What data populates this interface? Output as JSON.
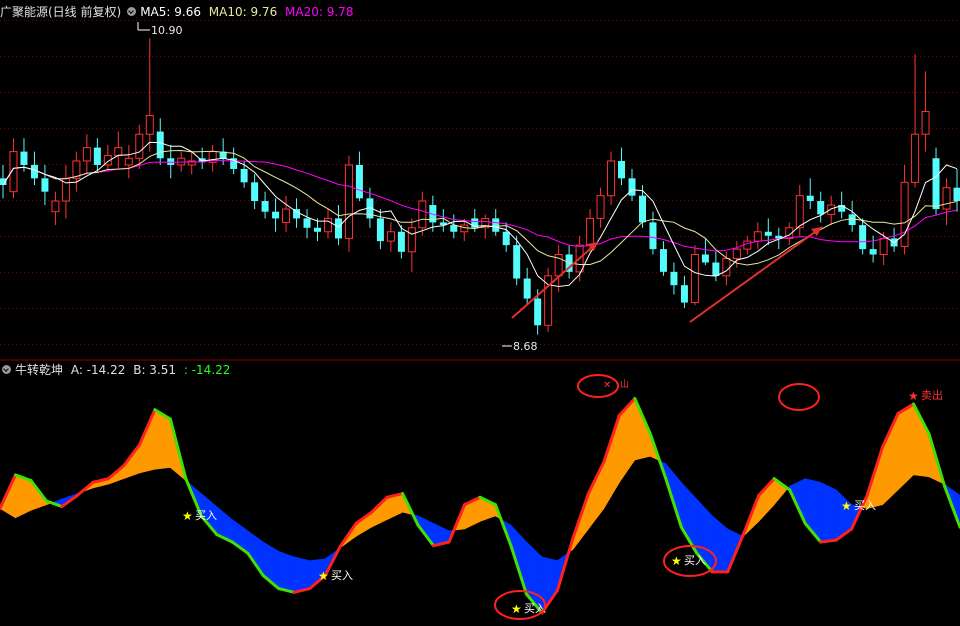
{
  "price_panel": {
    "title": "广聚能源(日线 前复权)",
    "ma5_label": "MA5: 9.66",
    "ma10_label": "MA10: 9.76",
    "ma20_label": "MA20: 9.78",
    "high_label": "10.90",
    "low_label": "8.68",
    "colors": {
      "up": "#ff3232",
      "down": "#54fcfc",
      "ma5": "#ffffff",
      "ma10": "#e8e8a0",
      "ma20": "#ff00ff",
      "grid": "#7a0000"
    }
  },
  "indicator_panel": {
    "title": "牛转乾坤",
    "a_label": "A: -14.22",
    "b_label": "B: 3.51",
    "c_label": ": -14.22",
    "colors": {
      "up_fill": "#ff9900",
      "down_fill": "#0033ff",
      "rise_line": "#ff2020",
      "fall_line": "#40e000",
      "star": "#ffff00",
      "circle": "#ff2020"
    }
  },
  "chart_data": [
    {
      "type": "candlestick",
      "title": "广聚能源(日线 前复权)",
      "ylim": [
        8.55,
        11.05
      ],
      "annotations": [
        {
          "text": "10.90",
          "value": 10.9
        },
        {
          "text": "8.68",
          "value": 8.68
        }
      ],
      "ohlc": [
        [
          9.85,
          9.95,
          9.7,
          9.8
        ],
        [
          9.75,
          10.15,
          9.7,
          10.05
        ],
        [
          10.05,
          10.15,
          9.9,
          9.95
        ],
        [
          9.95,
          10.05,
          9.8,
          9.85
        ],
        [
          9.85,
          9.95,
          9.65,
          9.75
        ],
        [
          9.6,
          9.75,
          9.5,
          9.68
        ],
        [
          9.68,
          9.95,
          9.55,
          9.85
        ],
        [
          9.85,
          10.05,
          9.75,
          9.98
        ],
        [
          9.98,
          10.18,
          9.88,
          10.08
        ],
        [
          10.08,
          10.15,
          9.9,
          9.95
        ],
        [
          9.95,
          10.1,
          9.9,
          10.02
        ],
        [
          10.02,
          10.2,
          9.92,
          10.08
        ],
        [
          9.95,
          10.1,
          9.85,
          10.0
        ],
        [
          10.0,
          10.25,
          9.92,
          10.18
        ],
        [
          10.18,
          10.9,
          10.05,
          10.32
        ],
        [
          10.2,
          10.3,
          9.95,
          10.0
        ],
        [
          10.0,
          10.1,
          9.85,
          9.95
        ],
        [
          9.95,
          10.05,
          9.9,
          10.0
        ],
        [
          9.95,
          10.05,
          9.88,
          9.98
        ],
        [
          10.0,
          10.08,
          9.92,
          9.97
        ],
        [
          9.97,
          10.1,
          9.9,
          10.05
        ],
        [
          10.05,
          10.15,
          9.95,
          10.0
        ],
        [
          10.0,
          10.08,
          9.88,
          9.92
        ],
        [
          9.92,
          9.98,
          9.78,
          9.82
        ],
        [
          9.82,
          9.88,
          9.62,
          9.68
        ],
        [
          9.68,
          9.75,
          9.55,
          9.6
        ],
        [
          9.6,
          9.7,
          9.45,
          9.55
        ],
        [
          9.52,
          9.72,
          9.45,
          9.62
        ],
        [
          9.62,
          9.7,
          9.48,
          9.55
        ],
        [
          9.55,
          9.62,
          9.4,
          9.48
        ],
        [
          9.48,
          9.55,
          9.38,
          9.45
        ],
        [
          9.45,
          9.62,
          9.4,
          9.55
        ],
        [
          9.55,
          9.65,
          9.35,
          9.4
        ],
        [
          9.4,
          10.02,
          9.3,
          9.95
        ],
        [
          9.95,
          10.05,
          9.68,
          9.7
        ],
        [
          9.7,
          9.78,
          9.48,
          9.55
        ],
        [
          9.55,
          9.62,
          9.32,
          9.38
        ],
        [
          9.38,
          9.52,
          9.3,
          9.45
        ],
        [
          9.45,
          9.5,
          9.25,
          9.3
        ],
        [
          9.3,
          9.55,
          9.15,
          9.48
        ],
        [
          9.48,
          9.75,
          9.42,
          9.68
        ],
        [
          9.65,
          9.72,
          9.45,
          9.52
        ],
        [
          9.52,
          9.62,
          9.45,
          9.5
        ],
        [
          9.5,
          9.58,
          9.4,
          9.45
        ],
        [
          9.45,
          9.55,
          9.38,
          9.5
        ],
        [
          9.55,
          9.62,
          9.45,
          9.48
        ],
        [
          9.48,
          9.58,
          9.4,
          9.55
        ],
        [
          9.55,
          9.62,
          9.42,
          9.45
        ],
        [
          9.45,
          9.52,
          9.3,
          9.35
        ],
        [
          9.35,
          9.42,
          9.05,
          9.1
        ],
        [
          9.1,
          9.18,
          8.9,
          8.95
        ],
        [
          8.95,
          9.02,
          8.68,
          8.75
        ],
        [
          8.75,
          9.18,
          8.7,
          9.12
        ],
        [
          9.12,
          9.35,
          9.0,
          9.28
        ],
        [
          9.28,
          9.35,
          9.1,
          9.15
        ],
        [
          9.15,
          9.42,
          9.08,
          9.35
        ],
        [
          9.35,
          9.62,
          9.3,
          9.55
        ],
        [
          9.55,
          9.78,
          9.48,
          9.72
        ],
        [
          9.72,
          10.05,
          9.65,
          9.98
        ],
        [
          9.98,
          10.08,
          9.8,
          9.85
        ],
        [
          9.85,
          9.92,
          9.68,
          9.72
        ],
        [
          9.72,
          9.8,
          9.48,
          9.52
        ],
        [
          9.52,
          9.6,
          9.28,
          9.32
        ],
        [
          9.32,
          9.38,
          9.12,
          9.15
        ],
        [
          9.15,
          9.22,
          8.98,
          9.05
        ],
        [
          9.05,
          9.12,
          8.88,
          8.92
        ],
        [
          8.92,
          9.35,
          8.9,
          9.28
        ],
        [
          9.28,
          9.4,
          9.2,
          9.22
        ],
        [
          9.22,
          9.3,
          9.08,
          9.12
        ],
        [
          9.12,
          9.3,
          9.05,
          9.25
        ],
        [
          9.25,
          9.38,
          9.18,
          9.32
        ],
        [
          9.32,
          9.42,
          9.28,
          9.38
        ],
        [
          9.38,
          9.52,
          9.32,
          9.45
        ],
        [
          9.45,
          9.55,
          9.35,
          9.42
        ],
        [
          9.42,
          9.48,
          9.32,
          9.4
        ],
        [
          9.4,
          9.52,
          9.35,
          9.48
        ],
        [
          9.48,
          9.8,
          9.42,
          9.72
        ],
        [
          9.72,
          9.85,
          9.62,
          9.68
        ],
        [
          9.68,
          9.75,
          9.52,
          9.58
        ],
        [
          9.58,
          9.72,
          9.5,
          9.65
        ],
        [
          9.65,
          9.75,
          9.55,
          9.6
        ],
        [
          9.58,
          9.68,
          9.45,
          9.5
        ],
        [
          9.5,
          9.55,
          9.28,
          9.32
        ],
        [
          9.32,
          9.42,
          9.22,
          9.28
        ],
        [
          9.28,
          9.45,
          9.2,
          9.4
        ],
        [
          9.4,
          9.48,
          9.3,
          9.34
        ],
        [
          9.34,
          9.95,
          9.28,
          9.82
        ],
        [
          9.82,
          10.78,
          9.78,
          10.18
        ],
        [
          10.18,
          10.65,
          10.05,
          10.35
        ],
        [
          10.0,
          10.08,
          9.58,
          9.62
        ],
        [
          9.62,
          9.85,
          9.5,
          9.78
        ],
        [
          9.78,
          9.92,
          9.6,
          9.68
        ]
      ]
    },
    {
      "type": "area",
      "title": "牛转乾坤",
      "ylim": [
        -20,
        112
      ],
      "series": [
        {
          "name": "A",
          "values": [
            42,
            60,
            57,
            46,
            43,
            49,
            56,
            58,
            65,
            76,
            95,
            90,
            58,
            38,
            28,
            24,
            18,
            6,
            -1,
            -3,
            -1,
            6,
            22,
            34,
            40,
            48,
            50,
            33,
            22,
            24,
            44,
            48,
            44,
            22,
            -4,
            -14,
            -2,
            26,
            50,
            67,
            92,
            101,
            82,
            58,
            32,
            18,
            8,
            8,
            28,
            49,
            58,
            52,
            34,
            24,
            25,
            31,
            49,
            75,
            93,
            98,
            82,
            54,
            32
          ]
        },
        {
          "name": "B",
          "values": [
            42,
            37,
            41,
            44,
            47,
            50,
            53,
            55,
            58,
            61,
            63,
            64,
            57,
            50,
            43,
            36,
            30,
            24,
            19,
            16,
            14,
            15,
            21,
            27,
            32,
            36,
            40,
            38,
            34,
            30,
            31,
            35,
            38,
            33,
            24,
            16,
            14,
            20,
            31,
            42,
            56,
            68,
            70,
            66,
            56,
            47,
            38,
            31,
            27,
            35,
            44,
            54,
            58,
            56,
            52,
            44,
            42,
            44,
            52,
            60,
            59,
            55,
            49
          ]
        }
      ],
      "annotations": [
        "买入",
        "买入",
        "买入",
        "买入",
        "买入",
        "买入",
        "卖出",
        "卖出",
        "卖出"
      ]
    }
  ]
}
